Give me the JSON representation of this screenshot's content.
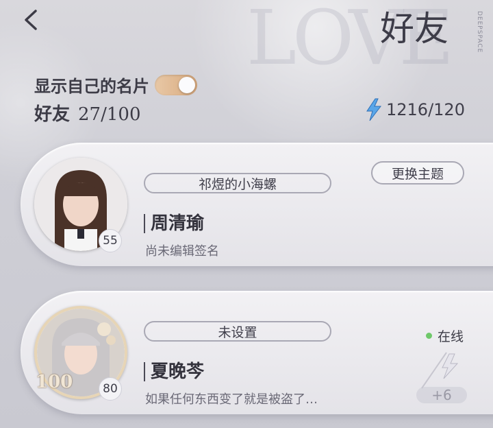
{
  "header": {
    "title": "好友",
    "brand": "DEEPSPACE",
    "watermark": "LOVE"
  },
  "profile_toggle": {
    "label": "显示自己的名片",
    "checked": true
  },
  "friends_summary": {
    "label": "好友",
    "count": "27/100"
  },
  "energy": {
    "value": "1216/120"
  },
  "friends": [
    {
      "tag": "祁煜的小海螺",
      "name": "周清瑜",
      "signature": "尚未编辑签名",
      "level": "55",
      "action_label": "更换主题"
    },
    {
      "tag": "未设置",
      "name": "夏晚芩",
      "signature": "如果任何东西变了就是被盗了…",
      "level": "80",
      "status": "在线",
      "frame_label": "100",
      "gift_count": "+6"
    }
  ]
}
